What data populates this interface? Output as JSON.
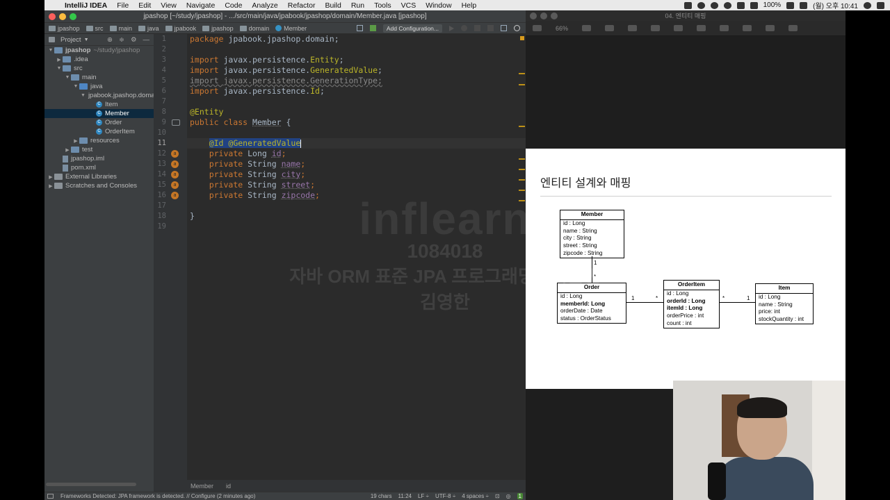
{
  "menubar": {
    "app": "IntelliJ IDEA",
    "items": [
      "File",
      "Edit",
      "View",
      "Navigate",
      "Code",
      "Analyze",
      "Refactor",
      "Build",
      "Run",
      "Tools",
      "VCS",
      "Window",
      "Help"
    ],
    "battery": "100%",
    "clock": "(월) 오후 10:41"
  },
  "ide": {
    "title": "jpashop [~/study/jpashop] - .../src/main/java/jpabook/jpashop/domain/Member.java [jpashop]",
    "breadcrumbs": [
      "jpashop",
      "src",
      "main",
      "java",
      "jpabook",
      "jpashop",
      "domain",
      "Member"
    ],
    "add_configuration": "Add Configuration...",
    "project_label": "Project",
    "tree": [
      {
        "label": "jpashop",
        "suffix": "~/study/jpashop",
        "indent": 0,
        "arrow": "▼",
        "icon": "folder"
      },
      {
        "label": ".idea",
        "indent": 1,
        "arrow": "▶",
        "icon": "folder"
      },
      {
        "label": "src",
        "indent": 1,
        "arrow": "▼",
        "icon": "folder"
      },
      {
        "label": "main",
        "indent": 2,
        "arrow": "▼",
        "icon": "folder"
      },
      {
        "label": "java",
        "indent": 3,
        "arrow": "▼",
        "icon": "src"
      },
      {
        "label": "jpabook.jpashop.domain",
        "indent": 4,
        "arrow": "▼",
        "icon": "package"
      },
      {
        "label": "Item",
        "indent": 5,
        "arrow": "",
        "icon": "class"
      },
      {
        "label": "Member",
        "indent": 5,
        "arrow": "",
        "icon": "class",
        "selected": true
      },
      {
        "label": "Order",
        "indent": 5,
        "arrow": "",
        "icon": "class"
      },
      {
        "label": "OrderItem",
        "indent": 5,
        "arrow": "",
        "icon": "class"
      },
      {
        "label": "resources",
        "indent": 3,
        "arrow": "▶",
        "icon": "folder"
      },
      {
        "label": "test",
        "indent": 2,
        "arrow": "▶",
        "icon": "folder"
      },
      {
        "label": "jpashop.iml",
        "indent": 1,
        "arrow": "",
        "icon": "file"
      },
      {
        "label": "pom.xml",
        "indent": 1,
        "arrow": "",
        "icon": "file"
      },
      {
        "label": "External Libraries",
        "indent": 0,
        "arrow": "▶",
        "icon": "lib"
      },
      {
        "label": "Scratches and Consoles",
        "indent": 0,
        "arrow": "▶",
        "icon": "lib"
      }
    ],
    "code_lines": [
      "1",
      "2",
      "3",
      "4",
      "5",
      "6",
      "7",
      "8",
      "9",
      "10",
      "11",
      "12",
      "13",
      "14",
      "15",
      "16",
      "17",
      "18",
      "19"
    ],
    "breadcrumb_bottom": [
      "Member",
      "id"
    ],
    "status": {
      "message": "Frameworks Detected: JPA framework is detected. // Configure (2 minutes ago)",
      "chars": "19 chars",
      "position": "11:24",
      "line_sep": "LF ÷",
      "encoding": "UTF-8 ÷",
      "indent": "4 spaces ÷"
    }
  },
  "watermark": {
    "logo": "inflearn",
    "id": "1084018",
    "line": "자바 ORM 표준 JPA 프로그래밍 - 기본편",
    "author": "김영한"
  },
  "keynote": {
    "title": "04. 엔티티 매핑",
    "zoom": "66%",
    "slide_title": "엔티티 설계와 매핑",
    "member": {
      "name": "Member",
      "attrs": [
        "id : Long",
        "name : String",
        "city : String",
        "street : String",
        "zipcode : String"
      ]
    },
    "order": {
      "name": "Order",
      "attrs": [
        "id : Long",
        "memberId: Long",
        "orderDate : Date",
        "status : OrderStatus"
      ]
    },
    "orderitem": {
      "name": "OrderItem",
      "attrs": [
        "id : Long",
        "orderId : Long",
        "itemId : Long",
        "orderPrice : int",
        "count : int"
      ]
    },
    "item": {
      "name": "Item",
      "attrs": [
        "id : Long",
        "name : String",
        "price: int",
        "stockQuantity : int"
      ]
    },
    "mult": {
      "member_order_top": "1",
      "member_order_bottom": "*",
      "order_oi_left": "1",
      "order_oi_right": "*",
      "oi_item_left": "*",
      "oi_item_right": "1"
    }
  }
}
